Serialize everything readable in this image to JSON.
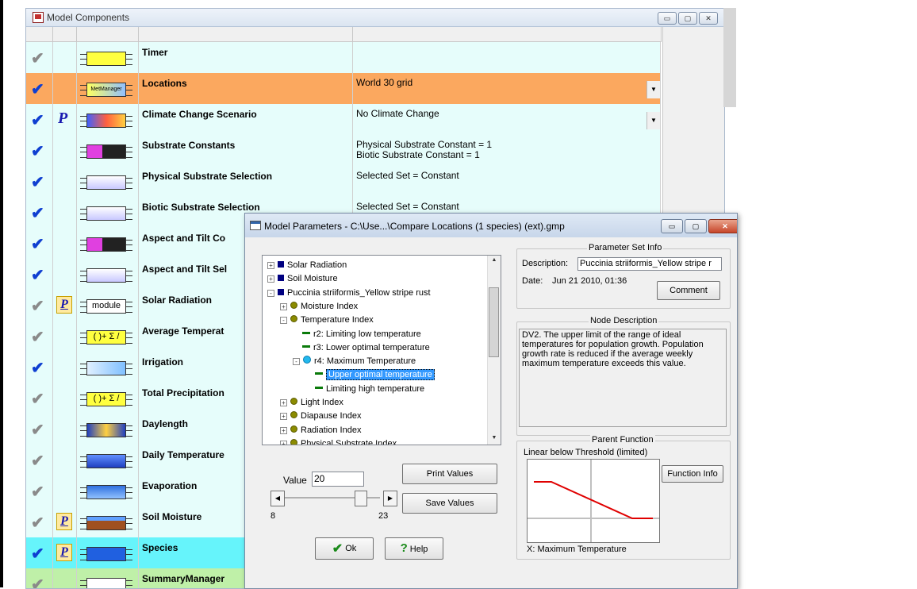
{
  "model_components": {
    "title": "Model Components",
    "rows": [
      {
        "check": "gray",
        "p": "",
        "icon": "timer-module-icon",
        "name": "Timer",
        "value": "",
        "value2": "",
        "bg": "#e6fdfb",
        "dropdown": false
      },
      {
        "check": "blue",
        "p": "",
        "icon": "metmanager-module-icon",
        "icon_label": "MetManager",
        "name": "Locations",
        "value": "World 30 grid",
        "value2": "",
        "bg": "#fba85f",
        "dropdown": true
      },
      {
        "check": "blue",
        "p": "P",
        "icon": "climate-change-module-icon",
        "name": "Climate Change Scenario",
        "value": "No Climate Change",
        "value2": "",
        "bg": "#e6fdfb",
        "dropdown": true
      },
      {
        "check": "blue",
        "p": "",
        "icon": "substrate-constants-module-icon",
        "name": "Substrate Constants",
        "value": "Physical Substrate Constant = 1",
        "value2": "Biotic Substrate Constant = 1",
        "bg": "#e6fdfb",
        "dropdown": false
      },
      {
        "check": "blue",
        "p": "",
        "icon": "selector-module-icon",
        "name": "Physical Substrate Selection",
        "value": "Selected Set = Constant",
        "value2": "",
        "bg": "#e6fdfb",
        "dropdown": false
      },
      {
        "check": "blue",
        "p": "",
        "icon": "selector-module-icon",
        "name": "Biotic Substrate Selection",
        "value": "Selected Set = Constant",
        "value2": "",
        "bg": "#e6fdfb",
        "dropdown": false
      },
      {
        "check": "blue",
        "p": "",
        "icon": "substrate-constants-module-icon",
        "name": "Aspect and Tilt Co",
        "value": "",
        "value2": "",
        "bg": "#e6fdfb",
        "dropdown": false
      },
      {
        "check": "blue",
        "p": "",
        "icon": "selector-module-icon",
        "name": "Aspect and Tilt Sel",
        "value": "",
        "value2": "",
        "bg": "#e6fdfb",
        "dropdown": false
      },
      {
        "check": "gray",
        "p": "Pbox",
        "icon": "generic-module-icon",
        "icon_label": "module",
        "name": "Solar Radiation",
        "value": "",
        "value2": "",
        "bg": "#e6fdfb",
        "dropdown": false
      },
      {
        "check": "gray",
        "p": "",
        "icon": "summation-module-icon",
        "icon_label": "( )+ Σ /",
        "name": "Average Temperat",
        "value": "",
        "value2": "",
        "bg": "#e6fdfb",
        "dropdown": false
      },
      {
        "check": "blue",
        "p": "",
        "icon": "irrigation-module-icon",
        "name": "Irrigation",
        "value": "",
        "value2": "",
        "bg": "#e6fdfb",
        "dropdown": false
      },
      {
        "check": "gray",
        "p": "",
        "icon": "summation-module-icon",
        "icon_label": "( )+ Σ /",
        "name": "Total Precipitation",
        "value": "",
        "value2": "",
        "bg": "#e6fdfb",
        "dropdown": false
      },
      {
        "check": "gray",
        "p": "",
        "icon": "daylength-module-icon",
        "name": "Daylength",
        "value": "",
        "value2": "",
        "bg": "#e6fdfb",
        "dropdown": false
      },
      {
        "check": "gray",
        "p": "",
        "icon": "daily-temperature-module-icon",
        "name": "Daily Temperature",
        "value": "",
        "value2": "",
        "bg": "#e6fdfb",
        "dropdown": false
      },
      {
        "check": "gray",
        "p": "",
        "icon": "evaporation-module-icon",
        "name": "Evaporation",
        "value": "",
        "value2": "",
        "bg": "#e6fdfb",
        "dropdown": false
      },
      {
        "check": "gray",
        "p": "Pbox",
        "icon": "soil-moisture-module-icon",
        "name": "Soil Moisture",
        "value": "",
        "value2": "",
        "bg": "#e6fdfb",
        "dropdown": false
      },
      {
        "check": "blue",
        "p": "Pbox",
        "icon": "species-module-icon",
        "name": "Species",
        "value": "",
        "value2": "",
        "bg": "#66f4fb",
        "dropdown": false
      },
      {
        "check": "gray",
        "p": "",
        "icon": "summary-manager-module-icon",
        "name": "SummaryManager",
        "value": "",
        "value2": "",
        "bg": "#bff0a8",
        "dropdown": false
      }
    ]
  },
  "dialog": {
    "title": "Model Parameters - C:\\Use...\\Compare Locations (1 species) (ext).gmp",
    "tree": [
      {
        "indent": 0,
        "expander": "+",
        "icon": "square",
        "label": "Solar Radiation",
        "selected": false
      },
      {
        "indent": 0,
        "expander": "+",
        "icon": "square",
        "label": "Soil Moisture",
        "selected": false
      },
      {
        "indent": 0,
        "expander": "-",
        "icon": "square",
        "label": "Puccinia striiformis_Yellow stripe rust",
        "selected": false
      },
      {
        "indent": 1,
        "expander": "+",
        "icon": "dot",
        "label": "Moisture Index",
        "selected": false
      },
      {
        "indent": 1,
        "expander": "-",
        "icon": "dot",
        "label": "Temperature Index",
        "selected": false
      },
      {
        "indent": 2,
        "expander": "",
        "icon": "dash",
        "label": "r2: Limiting low temperature",
        "selected": false
      },
      {
        "indent": 2,
        "expander": "",
        "icon": "dash",
        "label": "r3: Lower optimal temperature",
        "selected": false
      },
      {
        "indent": 2,
        "expander": "-",
        "icon": "cyan",
        "label": "r4: Maximum Temperature",
        "selected": false
      },
      {
        "indent": 3,
        "expander": "",
        "icon": "dash",
        "label": "Upper optimal temperature",
        "selected": true
      },
      {
        "indent": 3,
        "expander": "",
        "icon": "dash",
        "label": "Limiting high temperature",
        "selected": false
      },
      {
        "indent": 1,
        "expander": "+",
        "icon": "dot",
        "label": "Light Index",
        "selected": false
      },
      {
        "indent": 1,
        "expander": "+",
        "icon": "dot",
        "label": "Diapause Index",
        "selected": false
      },
      {
        "indent": 1,
        "expander": "+",
        "icon": "dot",
        "label": "Radiation Index",
        "selected": false
      },
      {
        "indent": 1,
        "expander": "+",
        "icon": "dot",
        "label": "Physical Substrate Index",
        "selected": false
      }
    ],
    "value_label": "Value",
    "value": "20",
    "slider_min": "8",
    "slider_max": "23",
    "slider_fraction": 0.8,
    "print_values": "Print Values",
    "save_values": "Save Values",
    "ok": "Ok",
    "help": "Help",
    "param_set_info": {
      "title": "Parameter Set Info",
      "description_label": "Description:",
      "description": "Puccinia striiformis_Yellow stripe r",
      "date_label": "Date:",
      "date": "Jun 21 2010, 01:36",
      "comment": "Comment"
    },
    "node_description": {
      "title": "Node Description",
      "text": "DV2. The upper limit of the range of ideal temperatures for population growth. Population growth rate is reduced if the average weekly maximum temperature exceeds this value."
    },
    "parent_function": {
      "title": "Parent Function",
      "name": "Linear below Threshold (limited)",
      "function_info": "Function Info",
      "x_label": "X: Maximum Temperature"
    }
  },
  "colors": {
    "accent_blue": "#0f3fd1",
    "selected_row": "#fba85f",
    "species_row": "#66f4fb",
    "summary_row": "#bff0a8",
    "row_bg": "#e6fdfb",
    "curve": "#e00000"
  }
}
